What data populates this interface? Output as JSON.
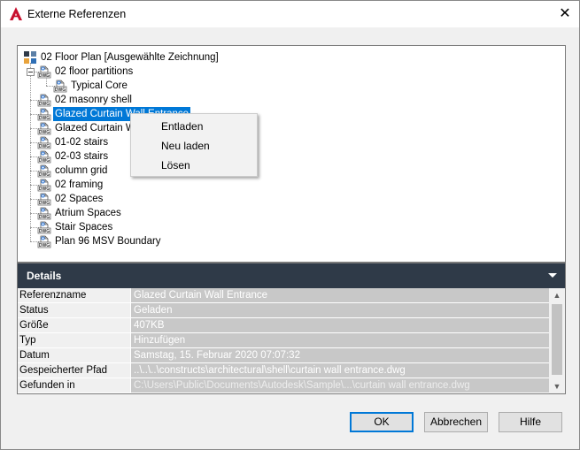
{
  "window": {
    "title": "Externe Referenzen",
    "close_glyph": "✕",
    "app_icon": "autocad-a-icon"
  },
  "tree": {
    "root": {
      "label": "02 Floor Plan [Ausgewählte Zeichnung]",
      "icon": "drawing-root-icon"
    },
    "nodes": [
      {
        "label": "02 floor partitions",
        "level": 1,
        "expanded": true,
        "icon": "dwg-xref-icon"
      },
      {
        "label": "Typical Core",
        "level": 2,
        "icon": "dwg-xref-icon"
      },
      {
        "label": "02 masonry shell",
        "level": 1,
        "icon": "dwg-xref-icon"
      },
      {
        "label": "Glazed Curtain Wall Entrance",
        "level": 1,
        "selected": true,
        "icon": "dwg-xref-icon"
      },
      {
        "label": "Glazed Curtain W",
        "level": 1,
        "icon": "dwg-xref-icon"
      },
      {
        "label": "01-02 stairs",
        "level": 1,
        "icon": "dwg-xref-icon"
      },
      {
        "label": "02-03 stairs",
        "level": 1,
        "icon": "dwg-xref-icon"
      },
      {
        "label": "column grid",
        "level": 1,
        "icon": "dwg-xref-icon"
      },
      {
        "label": "02 framing",
        "level": 1,
        "icon": "dwg-xref-icon"
      },
      {
        "label": "02 Spaces",
        "level": 1,
        "icon": "dwg-xref-icon"
      },
      {
        "label": "Atrium Spaces",
        "level": 1,
        "icon": "dwg-xref-icon"
      },
      {
        "label": "Stair Spaces",
        "level": 1,
        "icon": "dwg-xref-icon"
      },
      {
        "label": "Plan 96 MSV Boundary",
        "level": 1,
        "icon": "dwg-xref-icon"
      }
    ],
    "icon_text": "DWG"
  },
  "context_menu": {
    "items": [
      {
        "label": "Entladen"
      },
      {
        "label": "Neu laden"
      },
      {
        "label": "Lösen"
      }
    ]
  },
  "details": {
    "header": "Details",
    "rows": [
      {
        "name": "Referenzname",
        "value": "Glazed Curtain Wall Entrance"
      },
      {
        "name": "Status",
        "value": "Geladen"
      },
      {
        "name": "Größe",
        "value": "407KB"
      },
      {
        "name": "Typ",
        "value": "Hinzufügen"
      },
      {
        "name": "Datum",
        "value": "Samstag, 15. Februar 2020  07:07:32"
      },
      {
        "name": "Gespeicherter Pfad",
        "value": "..\\..\\..\\constructs\\architectural\\shell\\curtain wall entrance.dwg"
      },
      {
        "name": "Gefunden in",
        "value": "C:\\Users\\Public\\Documents\\Autodesk\\Sample\\...\\curtain wall entrance.dwg",
        "dim": true
      }
    ]
  },
  "buttons": {
    "ok": "OK",
    "cancel": "Abbrechen",
    "help": "Hilfe"
  },
  "colors": {
    "selection": "#0078d7",
    "details_header": "#2f3a48",
    "app_icon_red": "#c8102e"
  }
}
